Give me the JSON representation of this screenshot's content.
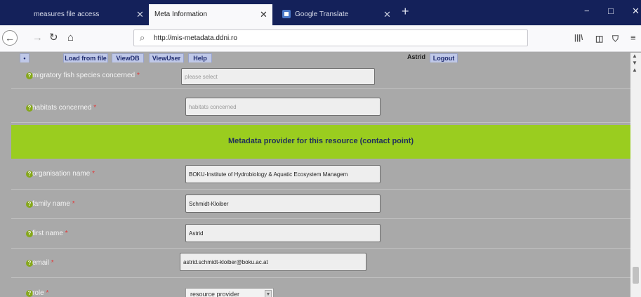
{
  "browser": {
    "tabs": [
      {
        "title": "measures file access",
        "active": false
      },
      {
        "title": "Meta Information",
        "active": true
      },
      {
        "title": "Google Translate",
        "active": false
      }
    ],
    "new_tab_symbol": "+",
    "url": "http://mis-metadata.ddni.ro",
    "window_controls": {
      "minimize": "−",
      "maximize": "□",
      "close": "✕"
    },
    "toolbar_icons": [
      "library-icon",
      "sidebar-icon",
      "shield-icon",
      "menu-icon"
    ]
  },
  "page": {
    "menu": {
      "dot": "•",
      "load_from_file": "Load from file",
      "view_db": "ViewDB",
      "view_user": "ViewUser",
      "help": "Help",
      "username": "Astrid",
      "logout": "Logout"
    },
    "fields_top": [
      {
        "label": "migratory fish species concerned",
        "required": "*",
        "value": "",
        "placeholder": "please select"
      },
      {
        "label": "habitats concerned",
        "required": "*",
        "value": "",
        "placeholder": "habitats concerned"
      }
    ],
    "section_title": "Metadata provider for this resource (contact point)",
    "contact_fields": [
      {
        "label": "organisation name",
        "required": "*",
        "value": "BOKU-Institute of Hydrobiology & Aquatic Ecosystem Managem"
      },
      {
        "label": "family name",
        "required": "*",
        "value": "Schmidt-Kloiber"
      },
      {
        "label": "first name",
        "required": "*",
        "value": "Astrid"
      },
      {
        "label": "email",
        "required": "*",
        "value": "astrid.schmidt-kloiber@boku.ac.at"
      }
    ],
    "role": {
      "label": "role",
      "required": "*",
      "selected": "resource provider"
    },
    "help_icon_glyph": "?"
  },
  "colors": {
    "tabbar": "#14215a",
    "page_bg": "#a9a9a9",
    "section_band": "#9acd1f",
    "help_icon": "#86a81b",
    "required_star": "#e23a3a"
  }
}
